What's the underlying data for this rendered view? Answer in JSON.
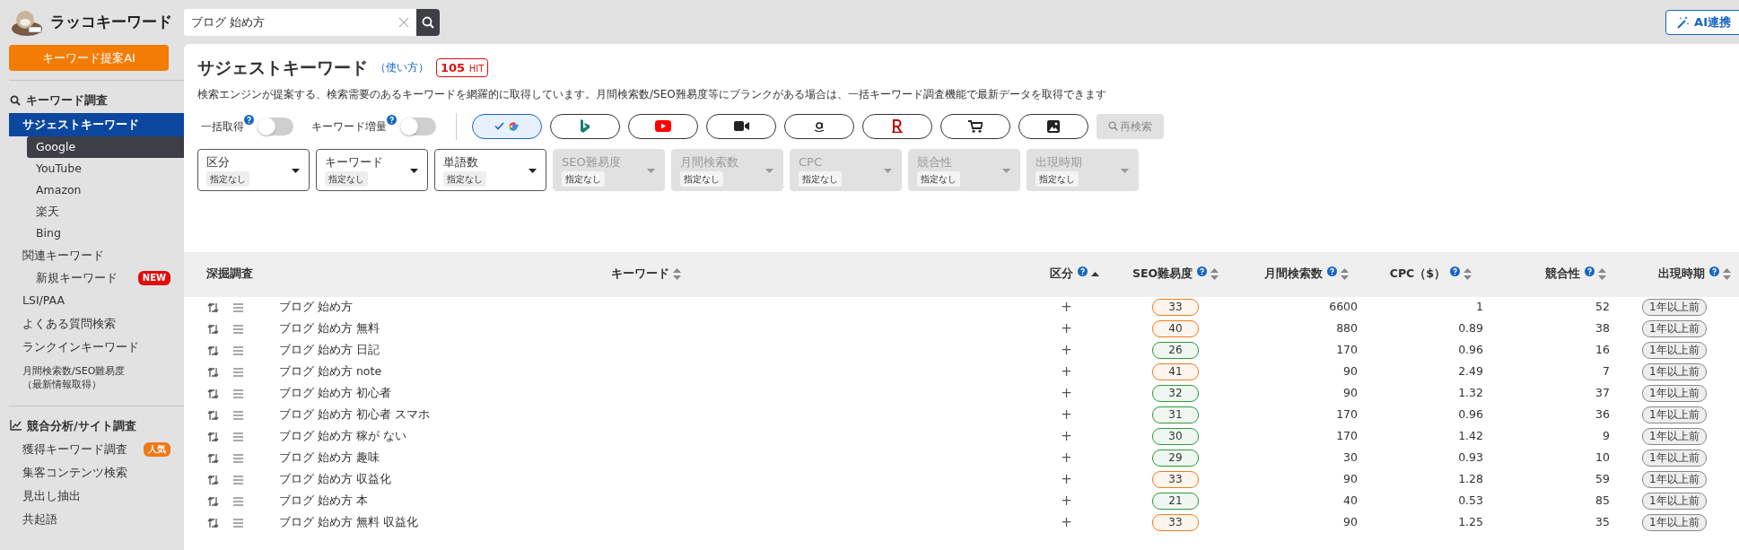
{
  "header": {
    "logo_text": "ラッコキーワード",
    "search": {
      "value": "ブログ 始め方"
    },
    "ai_button": "AI連携"
  },
  "sidebar": {
    "ai_button": "キーワード提案AI",
    "sections": [
      {
        "title": "キーワード調査",
        "kind": "search",
        "items": [
          {
            "label": "サジェストキーワード",
            "selected": true,
            "children": [
              {
                "label": "Google",
                "selected": true
              },
              {
                "label": "YouTube",
                "selected": false
              },
              {
                "label": "Amazon",
                "selected": false
              },
              {
                "label": "楽天",
                "selected": false
              },
              {
                "label": "Bing",
                "selected": false
              }
            ]
          },
          {
            "label": "関連キーワード",
            "selected": false,
            "children": [
              {
                "label": "新規キーワード",
                "selected": false,
                "badge": {
                  "text": "NEW",
                  "color": "#e00d0d"
                }
              }
            ]
          },
          {
            "label": "LSI/PAA",
            "selected": false
          },
          {
            "label": "よくある質問検索",
            "selected": false
          },
          {
            "label": "ランクインキーワード",
            "selected": false
          },
          {
            "label": "月間検索数/SEO難易度",
            "note": "（最新情報取得）",
            "selected": false
          }
        ]
      },
      {
        "title": "競合分析/サイト調査",
        "kind": "chart",
        "items": [
          {
            "label": "獲得キーワード調査",
            "selected": false,
            "badge": {
              "text": "人気",
              "color": "#f07818"
            }
          },
          {
            "label": "集客コンテンツ検索",
            "selected": false
          },
          {
            "label": "見出し抽出",
            "selected": false
          },
          {
            "label": "共起語",
            "selected": false
          }
        ]
      }
    ]
  },
  "panel": {
    "title": "サジェストキーワード",
    "help_link": "（使い方）",
    "hit_count": "105",
    "hit_label": "HIT",
    "description": {
      "before": "検索エンジンが提案する、検索需要のあるキーワードを網羅的に取得しています。月間検索数/SEO難易度等にブランクがある場合は、",
      "link": "一括キーワード調査機能",
      "after": "で最新データを取得できます"
    },
    "toggles": [
      {
        "label": "一括取得",
        "on": false
      },
      {
        "label": "キーワード増量",
        "on": false
      }
    ],
    "engines": [
      {
        "kind": "google",
        "selected": true
      },
      {
        "kind": "bing",
        "selected": false
      },
      {
        "kind": "youtube",
        "selected": false
      },
      {
        "kind": "video",
        "selected": false
      },
      {
        "kind": "amazon",
        "selected": false
      },
      {
        "kind": "rakuten",
        "selected": false
      },
      {
        "kind": "cart",
        "selected": false
      },
      {
        "kind": "image",
        "selected": false
      }
    ],
    "research_button": {
      "label": "再検索",
      "disabled": true
    },
    "filters": [
      {
        "label": "区分",
        "value": "指定なし",
        "disabled": false
      },
      {
        "label": "キーワード",
        "value": "指定なし",
        "disabled": false
      },
      {
        "label": "単語数",
        "value": "指定なし",
        "disabled": false
      },
      {
        "label": "SEO難易度",
        "value": "指定なし",
        "disabled": true
      },
      {
        "label": "月間検索数",
        "value": "指定なし",
        "disabled": true
      },
      {
        "label": "CPC",
        "value": "指定なし",
        "disabled": true
      },
      {
        "label": "競合性",
        "value": "指定なし",
        "disabled": true
      },
      {
        "label": "出現時期",
        "value": "指定なし",
        "disabled": true
      }
    ]
  },
  "table": {
    "columns": [
      {
        "label": "深掘調査",
        "help": false,
        "sortable": false,
        "sorted": false
      },
      {
        "label": "キーワード",
        "help": false,
        "sortable": true,
        "sorted": false
      },
      {
        "label": "区分",
        "help": true,
        "sortable": true,
        "sorted": true
      },
      {
        "label": "SEO難易度",
        "help": true,
        "sortable": true,
        "sorted": false
      },
      {
        "label": "月間検索数",
        "help": true,
        "sortable": true,
        "sorted": false
      },
      {
        "label": "CPC（$）",
        "help": true,
        "sortable": true,
        "sorted": false
      },
      {
        "label": "競合性",
        "help": true,
        "sortable": true,
        "sorted": false
      },
      {
        "label": "出現時期",
        "help": true,
        "sortable": true,
        "sorted": false
      }
    ],
    "rows": [
      {
        "keyword": "ブログ 始め方",
        "category": "+",
        "seo": "33",
        "color": "#f07d1a",
        "volume": "6600",
        "cpc": "1",
        "competition": "52",
        "period": "1年以上前"
      },
      {
        "keyword": "ブログ 始め方 無料",
        "category": "+",
        "seo": "40",
        "color": "#f07d1a",
        "volume": "880",
        "cpc": "0.89",
        "competition": "38",
        "period": "1年以上前"
      },
      {
        "keyword": "ブログ 始め方 日記",
        "category": "+",
        "seo": "26",
        "color": "#2e9a3a",
        "volume": "170",
        "cpc": "0.96",
        "competition": "16",
        "period": "1年以上前"
      },
      {
        "keyword": "ブログ 始め方 note",
        "category": "+",
        "seo": "41",
        "color": "#f07d1a",
        "volume": "90",
        "cpc": "2.49",
        "competition": "7",
        "period": "1年以上前"
      },
      {
        "keyword": "ブログ 始め方 初心者",
        "category": "+",
        "seo": "32",
        "color": "#2e9a3a",
        "volume": "90",
        "cpc": "1.32",
        "competition": "37",
        "period": "1年以上前"
      },
      {
        "keyword": "ブログ 始め方 初心者 スマホ",
        "category": "+",
        "seo": "31",
        "color": "#2e9a3a",
        "volume": "170",
        "cpc": "0.96",
        "competition": "36",
        "period": "1年以上前"
      },
      {
        "keyword": "ブログ 始め方 稼が ない",
        "category": "+",
        "seo": "30",
        "color": "#2e9a3a",
        "volume": "170",
        "cpc": "1.42",
        "competition": "9",
        "period": "1年以上前"
      },
      {
        "keyword": "ブログ 始め方 趣味",
        "category": "+",
        "seo": "29",
        "color": "#2e9a3a",
        "volume": "30",
        "cpc": "0.93",
        "competition": "10",
        "period": "1年以上前"
      },
      {
        "keyword": "ブログ 始め方 収益化",
        "category": "+",
        "seo": "33",
        "color": "#f07d1a",
        "volume": "90",
        "cpc": "1.28",
        "competition": "59",
        "period": "1年以上前"
      },
      {
        "keyword": "ブログ 始め方 本",
        "category": "+",
        "seo": "21",
        "color": "#2e9a3a",
        "volume": "40",
        "cpc": "0.53",
        "competition": "85",
        "period": "1年以上前"
      },
      {
        "keyword": "ブログ 始め方 無料 収益化",
        "category": "+",
        "seo": "33",
        "color": "#f07d1a",
        "volume": "90",
        "cpc": "1.25",
        "competition": "35",
        "period": "1年以上前"
      }
    ]
  }
}
